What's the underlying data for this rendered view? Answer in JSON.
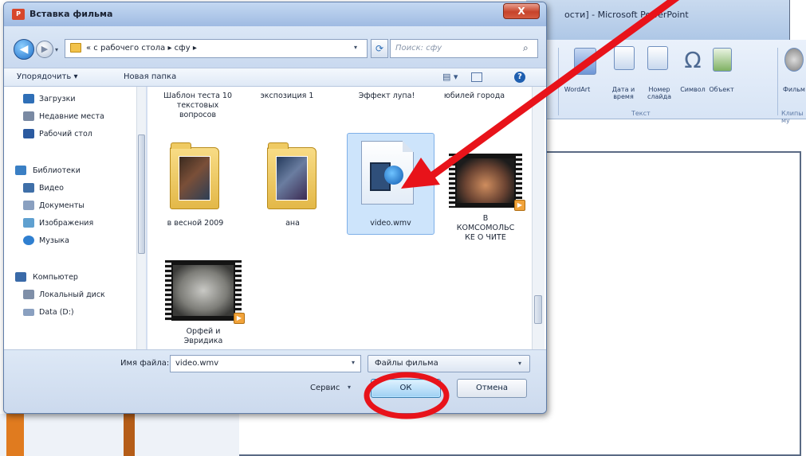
{
  "background_app": {
    "title_fragment": "ости] - Microsoft PowerPoint",
    "ribbon": {
      "wordart": "WordArt",
      "date_time": "Дата и время",
      "slide_number": "Номер слайда",
      "symbol": "Символ",
      "object": "Объект",
      "movie": "Фильм",
      "group_text": "Текст",
      "group_clips": "Клипы му"
    }
  },
  "dialog": {
    "title": "Вставка фильма",
    "close_label": "X",
    "address_path": "« с рабочего стола ▸ сфу ▸",
    "search_placeholder": "Поиск: сфу",
    "toolbar": {
      "organize": "Упорядочить ▾",
      "new_folder": "Новая папка"
    },
    "nav": [
      {
        "label": "Загрузки",
        "icon": "downloads-icon",
        "color": "#2f6fb7"
      },
      {
        "label": "Недавние места",
        "icon": "recent-places-icon",
        "color": "#7a8aa3"
      },
      {
        "label": "Рабочий стол",
        "icon": "desktop-icon",
        "color": "#2b5aa0"
      },
      {
        "label": "Библиотеки",
        "icon": "libraries-icon",
        "color": "#3a7fc4"
      },
      {
        "label": "Видео",
        "icon": "video-library-icon",
        "color": "#3f6fa8"
      },
      {
        "label": "Документы",
        "icon": "documents-icon",
        "color": "#8aa0c0"
      },
      {
        "label": "Изображения",
        "icon": "pictures-icon",
        "color": "#5fa0d0"
      },
      {
        "label": "Музыка",
        "icon": "music-icon",
        "color": "#2f7fd0"
      },
      {
        "label": "Компьютер",
        "icon": "computer-icon",
        "color": "#3a6aa8"
      },
      {
        "label": "Локальный диск",
        "icon": "local-disk-icon",
        "color": "#7f8fa8"
      },
      {
        "label": "Data (D:)",
        "icon": "drive-icon",
        "color": "#8aa0c0"
      }
    ],
    "top_captions": [
      "Шаблон теста 10\nтекстовых\nвопросов",
      "экспозиция 1",
      "Эффект лупа!",
      "юбилей города"
    ],
    "files": [
      {
        "label": "в весной 2009",
        "kind": "folder"
      },
      {
        "label": "ана",
        "kind": "folder"
      },
      {
        "label": "video.wmv",
        "kind": "video-file",
        "selected": true
      },
      {
        "label": "В\nКОМСОМОЛЬС\nКЕ О ЧИТЕ",
        "kind": "video-thumb"
      },
      {
        "label": "Орфей и\nЭвридика",
        "kind": "video-thumb"
      }
    ],
    "filename_label": "Имя файла:",
    "filename_value": "video.wmv",
    "filetype_value": "Файлы фильма",
    "service_label": "Сервис",
    "ok_label": "ОК",
    "cancel_label": "Отмена"
  },
  "colors": {
    "annotation_red": "#e8131a",
    "selection": "#cde4fb"
  }
}
